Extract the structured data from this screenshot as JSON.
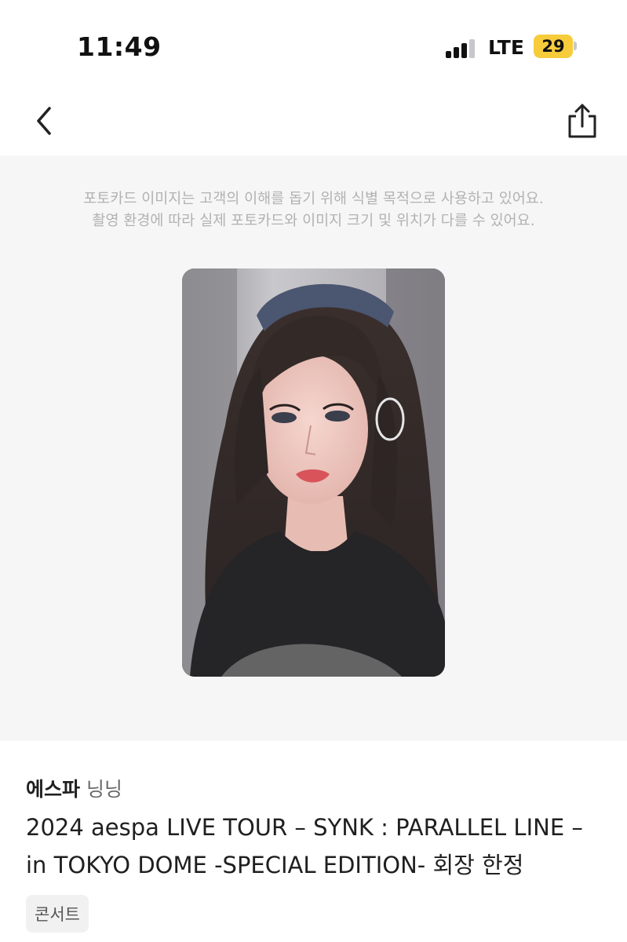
{
  "status_bar": {
    "time": "11:49",
    "network": "LTE",
    "battery": "29",
    "battery_color": "#f7cc3b"
  },
  "nav": {
    "back_icon": "chevron-left-icon",
    "share_icon": "share-icon"
  },
  "notice": {
    "line1": "포토카드 이미지는 고객의 이해를 돕기 위해 식별 목적으로 사용하고 있어요.",
    "line2": "촬영 환경에 따라 실제 포토카드와 이미지 크기 및 위치가 다를 수 있어요."
  },
  "photocard": {
    "image": "photocard-image"
  },
  "product": {
    "artist": "에스파",
    "member": "닝닝",
    "title_line1": "2024 aespa LIVE TOUR – SYNK : PARALLEL LINE –",
    "title_line2": "in TOKYO DOME -SPECIAL EDITION- 회장 한정",
    "category": "콘서트"
  }
}
